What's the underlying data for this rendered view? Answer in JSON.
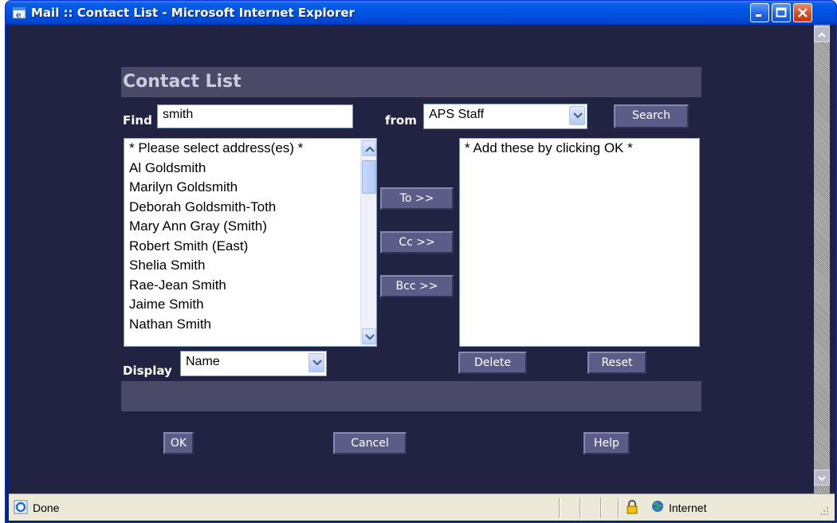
{
  "window": {
    "title": "Mail :: Contact List - Microsoft Internet Explorer"
  },
  "dialog": {
    "heading": "Contact List",
    "find_label": "Find",
    "find_value": "smith",
    "from_label": "from",
    "from_value": "APS Staff",
    "search_label": "Search",
    "address_list": [
      "* Please select address(es) *",
      "Al Goldsmith",
      "Marilyn Goldsmith",
      "Deborah Goldsmith-Toth",
      "Mary Ann Gray (Smith)",
      "Robert Smith (East)",
      "Shelia Smith",
      "Rae-Jean Smith",
      "Jaime Smith",
      "Nathan Smith"
    ],
    "to_label": "To >>",
    "cc_label": "Cc >>",
    "bcc_label": "Bcc >>",
    "selected_list": [
      "* Add these by clicking OK *"
    ],
    "display_label": "Display",
    "display_value": "Name",
    "delete_label": "Delete",
    "reset_label": "Reset",
    "ok_label": "OK",
    "cancel_label": "Cancel",
    "help_label": "Help"
  },
  "statusbar": {
    "status": "Done",
    "zone": "Internet"
  },
  "colors": {
    "background": "#222242",
    "panel": "#4a4a68",
    "button": "#5c5c88",
    "titlebar": "#0055e5"
  }
}
